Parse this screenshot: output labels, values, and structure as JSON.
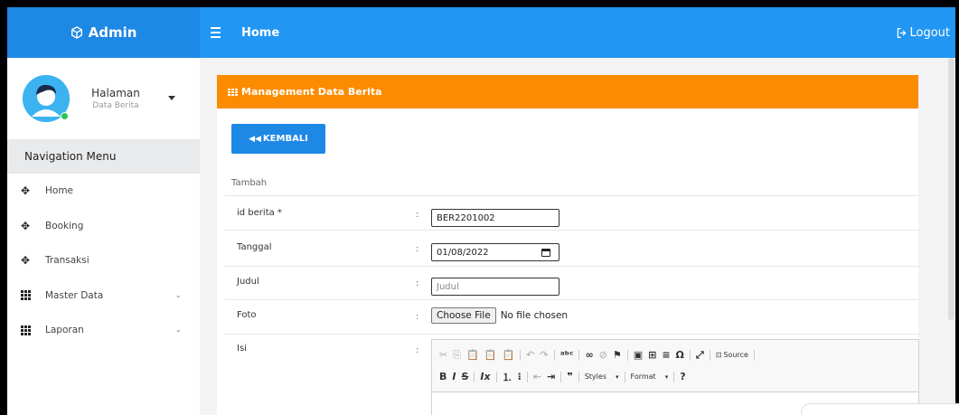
{
  "header": {
    "brand_title": "Admin",
    "page_title": "Home",
    "logout_label": "Logout",
    "brand_color": "#1e88e5",
    "topbar_color": "#2196f3"
  },
  "sidebar": {
    "profile": {
      "name": "Halaman",
      "subtitle": "Data Berita"
    },
    "nav_heading": "Navigation Menu",
    "items": [
      {
        "label": "Home",
        "icon": "arrows-move-icon"
      },
      {
        "label": "Booking",
        "icon": "arrows-move-icon"
      },
      {
        "label": "Transaksi",
        "icon": "arrows-move-icon"
      },
      {
        "label": "Master Data",
        "icon": "grid-icon",
        "has_submenu": true
      },
      {
        "label": "Laporan",
        "icon": "grid-icon",
        "has_submenu": true
      }
    ]
  },
  "panel": {
    "title": "Management Data Berita",
    "header_color": "#fb8c00",
    "back_button": "KEMBALI",
    "subtitle": "Tambah"
  },
  "form": {
    "fields": [
      {
        "label": "id berita *",
        "value": "BER2201002"
      },
      {
        "label": "Tanggal",
        "value": "01/08/2022"
      },
      {
        "label": "Judul",
        "value": "",
        "placeholder": "Judul"
      },
      {
        "label": "Foto",
        "file_button": "Choose File",
        "file_status": "No file chosen"
      },
      {
        "label": "Isi"
      }
    ],
    "colon": ":"
  },
  "editor": {
    "source_label": "Source",
    "styles_label": "Styles",
    "format_label": "Format",
    "help_label": "?"
  }
}
